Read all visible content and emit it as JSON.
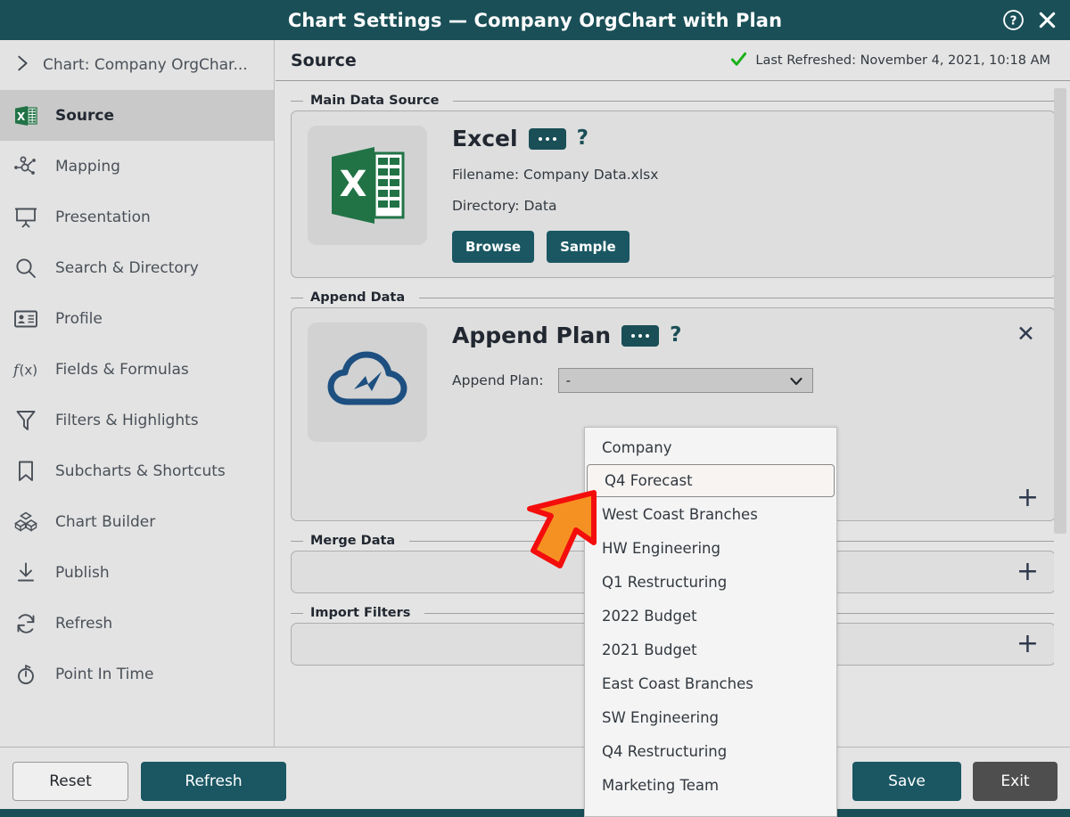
{
  "window": {
    "title": "Chart Settings — Company OrgChart with Plan",
    "help_icon": "question-circle-icon",
    "close_icon": "close-icon"
  },
  "sidebar": {
    "breadcrumb": {
      "label": "Chart: Company OrgChar...",
      "icon": "chevron-right-icon"
    },
    "items": [
      {
        "label": "Source",
        "icon": "excel-icon",
        "active": true
      },
      {
        "label": "Mapping",
        "icon": "mapping-icon",
        "active": false
      },
      {
        "label": "Presentation",
        "icon": "presentation-icon",
        "active": false
      },
      {
        "label": "Search & Directory",
        "icon": "search-icon",
        "active": false
      },
      {
        "label": "Profile",
        "icon": "profile-card-icon",
        "active": false
      },
      {
        "label": "Fields & Formulas",
        "icon": "function-icon",
        "active": false
      },
      {
        "label": "Filters & Highlights",
        "icon": "funnel-icon",
        "active": false
      },
      {
        "label": "Subcharts & Shortcuts",
        "icon": "bookmark-icon",
        "active": false
      },
      {
        "label": "Chart Builder",
        "icon": "blocks-icon",
        "active": false
      },
      {
        "label": "Publish",
        "icon": "publish-icon",
        "active": false
      },
      {
        "label": "Refresh",
        "icon": "refresh-icon",
        "active": false
      },
      {
        "label": "Point In Time",
        "icon": "stopwatch-icon",
        "active": false
      }
    ]
  },
  "content": {
    "title": "Source",
    "status": {
      "icon": "green-check-icon",
      "text": "Last Refreshed: November 4, 2021, 10:18 AM"
    },
    "main_data_source": {
      "legend": "Main Data Source",
      "logo_icon": "excel-logo-icon",
      "card_title": "Excel",
      "more_button": "more-options-button",
      "help_label": "?",
      "filename_line": "Filename: Company Data.xlsx",
      "directory_line": "Directory: Data",
      "browse_label": "Browse",
      "sample_label": "Sample"
    },
    "append_data": {
      "legend": "Append Data",
      "logo_icon": "cloud-plan-icon",
      "card_title": "Append Plan",
      "more_button": "more-options-button",
      "help_label": "?",
      "close_label": "✕",
      "field_label": "Append Plan:",
      "select_value": "-",
      "add_label": "+",
      "options": [
        "Company",
        "Q4 Forecast",
        "West Coast Branches",
        "HW Engineering",
        "Q1 Restructuring",
        "2022 Budget",
        "2021 Budget",
        "East Coast Branches",
        "SW Engineering",
        "Q4 Restructuring",
        "Marketing Team"
      ],
      "highlighted_option": "Q4 Forecast"
    },
    "merge_data": {
      "legend": "Merge Data",
      "add_label": "+"
    },
    "import_filters": {
      "legend": "Import Filters",
      "add_label": "+"
    }
  },
  "footer": {
    "reset_label": "Reset",
    "refresh_label": "Refresh",
    "save_label": "Save",
    "exit_label": "Exit"
  },
  "annotation": {
    "arrow_icon": "orange-arrow-pointer",
    "fill_color": "#F59123",
    "stroke_color": "#F40D0D"
  },
  "colors": {
    "titlebar": "#1a4f57",
    "accent_teal": "#1a5763",
    "excel_green": "#217346",
    "cloud_blue": "#1d4f80",
    "check_green": "#18b118"
  }
}
